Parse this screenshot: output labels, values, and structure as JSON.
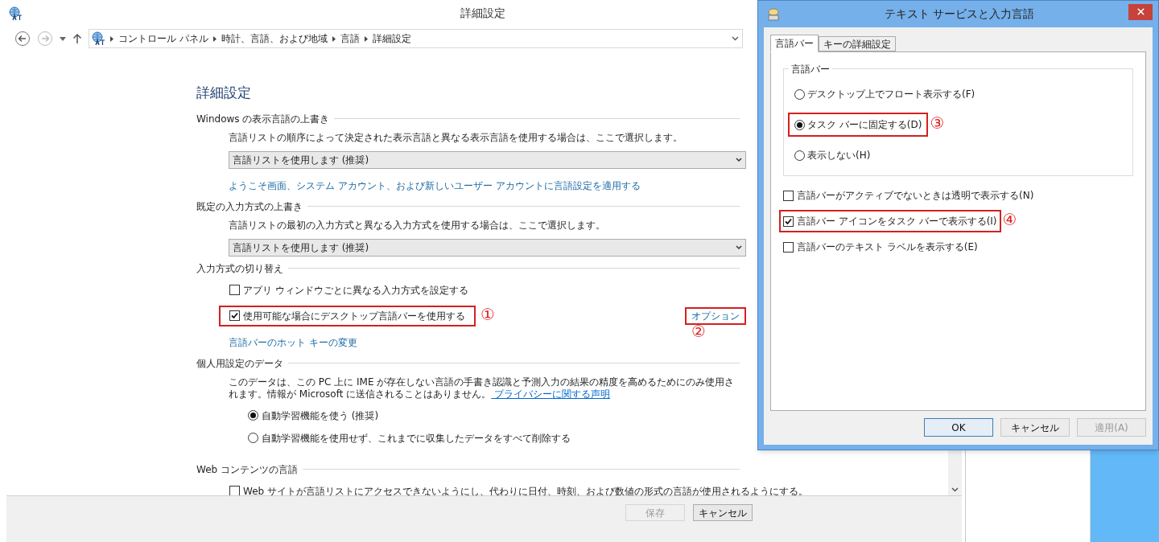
{
  "main_window": {
    "title": "詳細設定",
    "breadcrumb": [
      "コントロール パネル",
      "時計、言語、および地域",
      "言語",
      "詳細設定"
    ],
    "heading": "詳細設定",
    "sections": [
      {
        "title": "Windows の表示言語の上書き",
        "items": [
          {
            "kind": "text",
            "text": "言語リストの順序によって決定された表示言語と異なる表示言語を使用する場合は、ここで選択します。"
          },
          {
            "kind": "dropdown",
            "value": "言語リストを使用します (推奨)"
          },
          {
            "kind": "link",
            "text": "ようこそ画面、システム アカウント、および新しいユーザー アカウントに言語設定を適用する"
          }
        ]
      },
      {
        "title": "既定の入力方式の上書き",
        "items": [
          {
            "kind": "text",
            "text": "言語リストの最初の入力方式と異なる入力方式を使用する場合は、ここで選択します。"
          },
          {
            "kind": "dropdown",
            "value": "言語リストを使用します (推奨)"
          }
        ]
      },
      {
        "title": "入力方式の切り替え",
        "items": [
          {
            "kind": "checkbox",
            "label": "アプリ ウィンドウごとに異なる入力方式を設定する",
            "checked": false,
            "highlighted": false
          },
          {
            "kind": "checkbox",
            "label": "使用可能な場合にデスクトップ言語バーを使用する",
            "checked": true,
            "highlighted": true,
            "annotation": "①",
            "side_link": {
              "text": "オプション",
              "highlighted": true,
              "annotation": "②"
            }
          },
          {
            "kind": "link",
            "text": "言語バーのホット キーの変更"
          }
        ]
      },
      {
        "title": "個人用設定のデータ",
        "items": [
          {
            "kind": "text",
            "text": "このデータは、この PC 上に IME が存在しない言語の手書き認識と予測入力の結果の精度を高めるためにのみ使用されます。情報が Microsoft に送信されることはありません。",
            "link": "プライバシーに関する声明"
          },
          {
            "kind": "radio",
            "label": "自動学習機能を使う (推奨)",
            "selected": true
          },
          {
            "kind": "radio",
            "label": "自動学習機能を使用せず、これまでに収集したデータをすべて削除する",
            "selected": false
          }
        ]
      },
      {
        "title": "Web コンテンツの言語",
        "items": [
          {
            "kind": "checkbox",
            "label": "Web サイトが言語リストにアクセスできないようにし、代わりに日付、時刻、および数値の形式の言語が使用されるようにする。",
            "checked": false,
            "highlighted": false
          }
        ]
      }
    ],
    "buttons": [
      {
        "label": "保存",
        "disabled": true
      },
      {
        "label": "キャンセル",
        "disabled": false
      }
    ]
  },
  "dialog": {
    "title": "テキスト サービスと入力言語",
    "tabs": [
      {
        "label": "言語バー",
        "selected": true
      },
      {
        "label": "キーの詳細設定",
        "selected": false
      }
    ],
    "group": {
      "title": "言語バー",
      "options": [
        {
          "label": "デスクトップ上でフロート表示する(F)",
          "selected": false,
          "highlighted": false
        },
        {
          "label": "タスク バーに固定する(D)",
          "selected": true,
          "highlighted": true,
          "annotation": "③"
        },
        {
          "label": "表示しない(H)",
          "selected": false,
          "highlighted": false
        }
      ]
    },
    "checkboxes": [
      {
        "label": "言語バーがアクティブでないときは透明で表示する(N)",
        "checked": false,
        "highlighted": false
      },
      {
        "label": "言語バー アイコンをタスク バーで表示する(I)",
        "checked": true,
        "highlighted": true,
        "annotation": "④"
      },
      {
        "label": "言語バーのテキスト ラベルを表示する(E)",
        "checked": false,
        "highlighted": false
      }
    ],
    "buttons": [
      {
        "label": "OK",
        "kind": "default",
        "disabled": false
      },
      {
        "label": "キャンセル",
        "kind": "normal",
        "disabled": false
      },
      {
        "label": "適用(A)",
        "kind": "normal",
        "disabled": true
      }
    ]
  }
}
